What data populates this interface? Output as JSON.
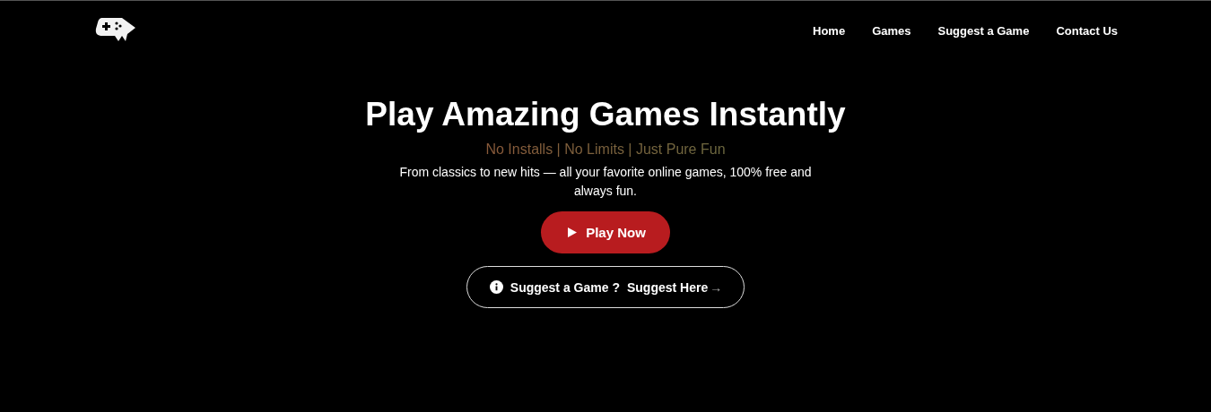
{
  "nav": {
    "links": [
      {
        "label": "Home"
      },
      {
        "label": "Games"
      },
      {
        "label": "Suggest a Game"
      },
      {
        "label": "Contact Us"
      }
    ]
  },
  "hero": {
    "title": "Play Amazing Games Instantly",
    "tagline": "No Installs | No Limits | Just Pure Fun",
    "description": "From classics to new hits — all your favorite online games, 100% free and always fun.",
    "play_button": {
      "label": "Play Now"
    },
    "suggest_button": {
      "prompt": "Suggest a Game ?",
      "link": "Suggest Here",
      "arrow": "→"
    }
  }
}
